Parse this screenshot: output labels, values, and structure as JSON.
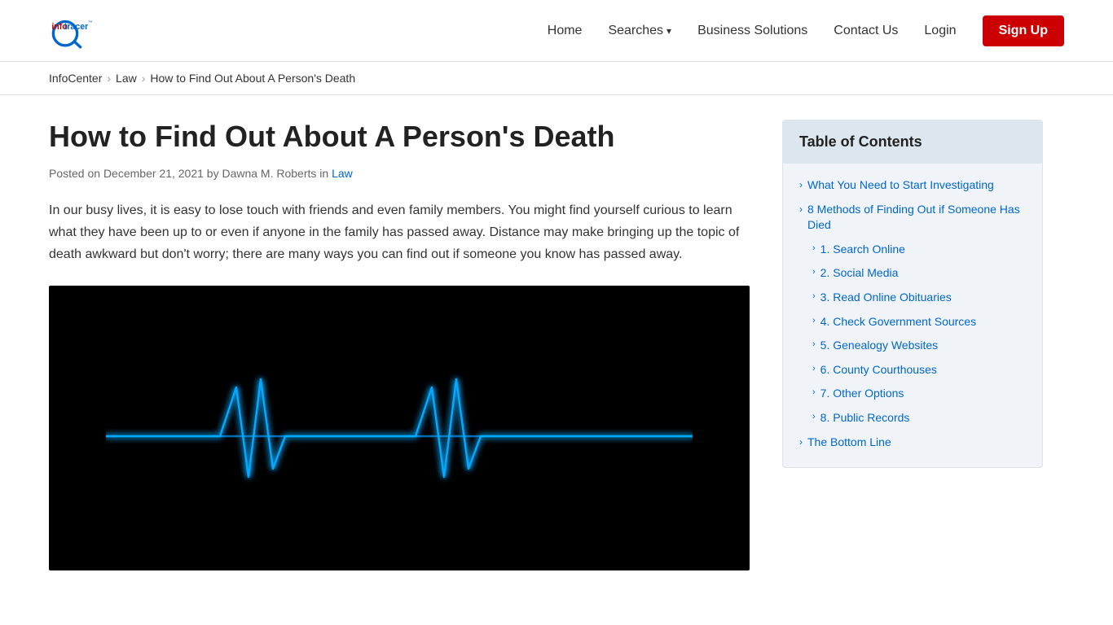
{
  "header": {
    "logo_info": "info",
    "logo_tracer": "tracer",
    "logo_tm": "™",
    "nav": {
      "home": "Home",
      "searches": "Searches",
      "searches_chevron": "▾",
      "business_solutions": "Business Solutions",
      "contact_us": "Contact Us",
      "login": "Login",
      "signup": "Sign Up"
    }
  },
  "breadcrumb": {
    "items": [
      "InfoCenter",
      "Law",
      "How to Find Out About A Person's Death"
    ],
    "separators": [
      "›",
      "›"
    ]
  },
  "article": {
    "title": "How to Find Out About A Person's Death",
    "meta": "Posted on December 21, 2021 by Dawna M. Roberts in ",
    "meta_link": "Law",
    "intro": " In our busy lives, it is easy to lose touch with friends and even family members. You might find yourself curious to learn what they have been up to or even if anyone in the family has passed away. Distance may make bringing up the topic of death awkward but don't worry; there are many ways you can find out if someone you know has passed away."
  },
  "toc": {
    "header": "Table of Contents",
    "items": [
      {
        "label": "What You Need to Start Investigating",
        "sub": false
      },
      {
        "label": "8 Methods of Finding Out if Someone Has Died",
        "sub": false
      },
      {
        "label": "1. Search Online",
        "sub": true
      },
      {
        "label": "2. Social Media",
        "sub": true
      },
      {
        "label": "3. Read Online Obituaries",
        "sub": true
      },
      {
        "label": "4. Check Government Sources",
        "sub": true
      },
      {
        "label": "5. Genealogy Websites",
        "sub": true
      },
      {
        "label": "6. County Courthouses",
        "sub": true
      },
      {
        "label": "7. Other Options",
        "sub": true
      },
      {
        "label": "8. Public Records",
        "sub": true
      },
      {
        "label": "The Bottom Line",
        "sub": false
      }
    ]
  },
  "colors": {
    "accent_red": "#cc0000",
    "accent_blue": "#0066cc",
    "toc_bg": "#f0f4f8",
    "toc_header_bg": "#dce6ef"
  }
}
